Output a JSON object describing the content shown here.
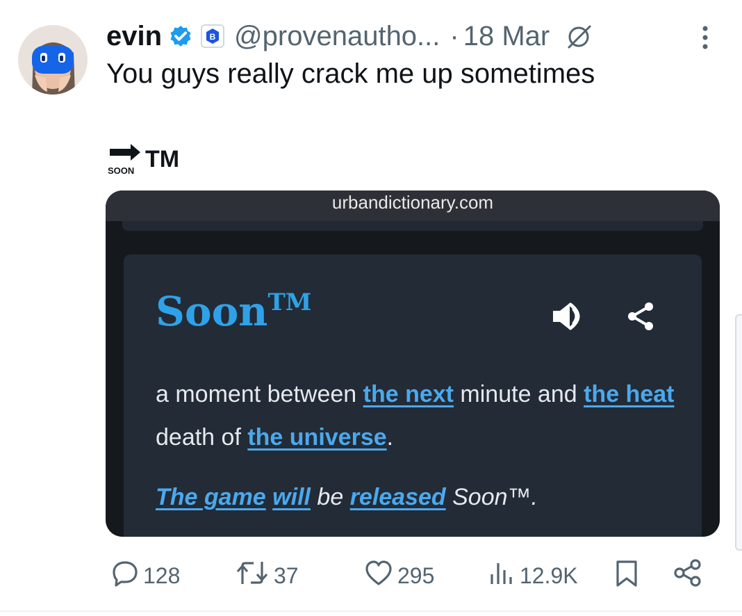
{
  "tweet": {
    "display_name": "evin",
    "handle": "@provenautho...",
    "dot": "·",
    "date": "18 Mar",
    "text": "You guys really crack me up sometimes",
    "emoji_label": "SOON",
    "emoji_suffix": "TM"
  },
  "media": {
    "url": "urbandictionary.com",
    "word": "Soon",
    "word_mark": "TM",
    "definition": {
      "t1": "a moment between ",
      "l1": "the next",
      "t2": " minute and ",
      "l2": "the heat",
      "t3": " death of ",
      "l3": "the universe",
      "t4": "."
    },
    "example": {
      "l1": "The game",
      "s1": " ",
      "l2": "will",
      "t1": " be ",
      "l3": "released",
      "t2": " Soon™."
    }
  },
  "actions": {
    "replies": "128",
    "retweets": "37",
    "likes": "295",
    "views": "12.9K"
  },
  "colors": {
    "verified_blue": "#1d9bf0",
    "link_blue": "#4aa9ee",
    "word_blue": "#2ea2e8",
    "muted_text": "#536471",
    "card_bg": "#232b36",
    "media_bg": "#15191e"
  },
  "icons": [
    "verified-badge-icon",
    "affiliate-badge-icon",
    "grok-icon",
    "more-icon",
    "speaker-icon",
    "share-icon",
    "reply-icon",
    "retweet-icon",
    "like-icon",
    "views-icon",
    "bookmark-icon",
    "share-post-icon"
  ]
}
